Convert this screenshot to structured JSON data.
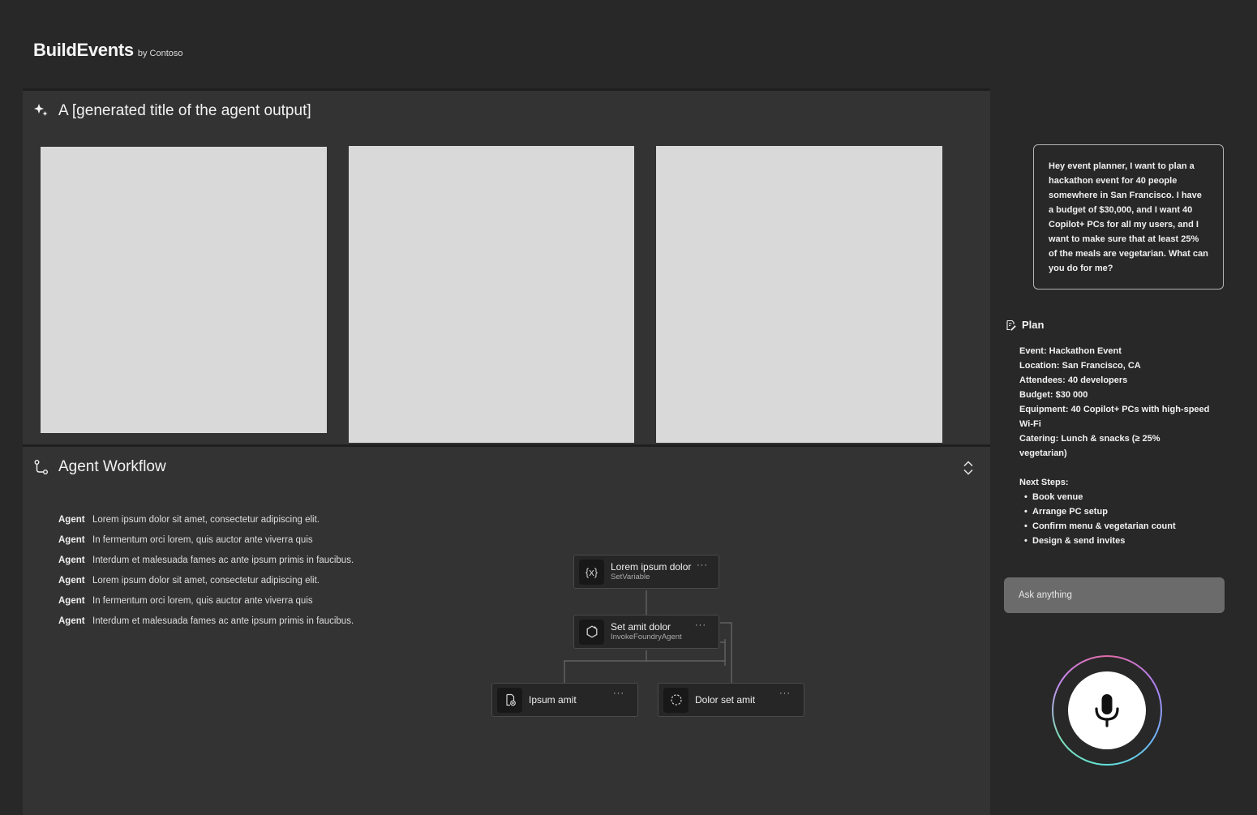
{
  "header": {
    "brand": "BuildEvents",
    "by": "by Contoso"
  },
  "output": {
    "title": "A [generated title of the agent output]",
    "icon": "sparkle-icon"
  },
  "workflow": {
    "title": "Agent Workflow",
    "icon": "workflow-icon",
    "log": [
      {
        "agent": "Agent",
        "text": "Lorem ipsum dolor sit amet, consectetur adipiscing elit."
      },
      {
        "agent": "Agent",
        "text": "In fermentum orci lorem, quis auctor ante viverra quis"
      },
      {
        "agent": "Agent",
        "text": "Interdum et malesuada fames ac ante ipsum primis in faucibus."
      },
      {
        "agent": "Agent",
        "text": "Lorem ipsum dolor sit amet, consectetur adipiscing elit."
      },
      {
        "agent": "Agent",
        "text": "In fermentum orci lorem, quis auctor ante viverra quis"
      },
      {
        "agent": "Agent",
        "text": "Interdum et malesuada fames ac ante ipsum primis in faucibus."
      }
    ],
    "nodes": [
      {
        "title": "Lorem ipsum dolor",
        "subtitle": "SetVariable",
        "more": "···",
        "icon": "variable-icon"
      },
      {
        "title": "Set amit dolor",
        "subtitle": "InvokeFoundryAgent",
        "more": "···",
        "icon": "agent-icon"
      },
      {
        "title": "Ipsum amit",
        "more": "···",
        "icon": "document-icon"
      },
      {
        "title": "Dolor set amit",
        "more": "···",
        "icon": "loop-icon"
      }
    ]
  },
  "chat": {
    "user_message": "Hey event planner, I want to plan a hackathon event for 40 people somewhere in San Francisco. I have a budget of $30,000, and I want 40 Copilot+ PCs for all my users, and I want to make sure that at least 25% of the meals are vegetarian. What can you do for me?",
    "plan": {
      "heading": "Plan",
      "lines": [
        "Event: Hackathon Event",
        "Location: San Francisco, CA",
        "Attendees: 40 developers",
        "Budget: $30 000",
        "Equipment: 40 Copilot+ PCs with high-speed Wi-Fi",
        "Catering: Lunch & snacks (≥ 25% vegetarian)"
      ],
      "next_heading": "Next Steps:",
      "next_steps": [
        "Book venue",
        "Arrange PC setup",
        "Confirm menu & vegetarian count",
        "Design & send invites"
      ]
    },
    "input_placeholder": "Ask anything"
  },
  "colors": {
    "background": "#282828",
    "panel": "#333333",
    "card": "#d9d9d9",
    "input": "#6b6b6b"
  }
}
